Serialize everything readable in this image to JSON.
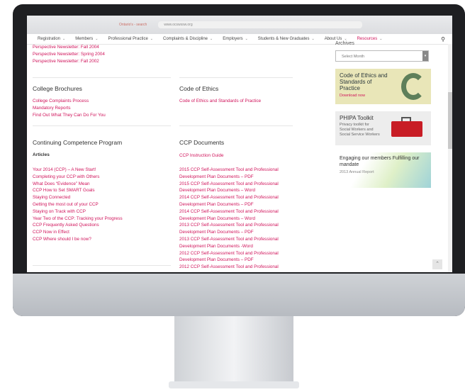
{
  "browser": {
    "tab1": "Ontario's - search",
    "address": "www.ocswssw.org"
  },
  "nav": {
    "items": [
      {
        "label": "Registration",
        "active": false
      },
      {
        "label": "Members",
        "active": false
      },
      {
        "label": "Professional Practice",
        "active": false
      },
      {
        "label": "Complaints & Discipline",
        "active": false
      },
      {
        "label": "Employers",
        "active": false
      },
      {
        "label": "Students & New Graduates",
        "active": false
      },
      {
        "label": "About Us",
        "active": false
      },
      {
        "label": "Resources",
        "active": true
      }
    ]
  },
  "newsletters": [
    "Perspective Newsletter: Fall 2004",
    "Perspective Newsletter: Spring 2004",
    "Perspective Newsletter: Fall 2002"
  ],
  "brochures": {
    "title": "College Brochures",
    "links": [
      "College Complaints Process",
      "Mandatory Reports",
      "Find Out What They Can Do For You"
    ]
  },
  "ethics": {
    "title": "Code of Ethics",
    "links": [
      "Code of Ethics and Standards of Practice"
    ]
  },
  "ccp": {
    "title": "Continuing Competence Program",
    "subhead": "Articles",
    "links": [
      "Your 2014 (CCP) – A New Start!",
      "Completing your CCP with Others",
      "What Does “Evidence” Mean",
      "CCP How to Set SMART Goals",
      "Staying Connected",
      "Getting the most out of your CCP",
      "Staying on Track with CCP",
      "Year Two of the CCP: Tracking your Progress",
      "CCP Frequently Asked Questions",
      "CCP Now in Effect",
      "CCP Where should I be now?"
    ]
  },
  "ccpdocs": {
    "title": "CCP Documents",
    "guide": "CCP Instruction Guide",
    "links": [
      "2015 CCP Self-Assessment Tool and Professional",
      "Development Plan Documents – PDF",
      "2015 CCP Self-Assessment Tool and Professional",
      "Development Plan Documents – Word",
      "2014 CCP Self-Assessment Tool and Professional",
      "Development Plan Documents – PDF",
      "2014 CCP Self-Assessment Tool and Professional",
      "Development Plan Documents – Word",
      "2013 CCP Self-Assessment Tool and Professional",
      "Development Plan Documents – PDF",
      "2013 CCP Self-Assessment Tool and Professional",
      "Development Plan Documents -Word",
      "2012 CCP Self-Assessment Tool and Professional",
      "Development Plan Documents – PDF",
      "2012 CCP Self-Assessment Tool and Professional"
    ]
  },
  "sidebar": {
    "archives_title": "Archives",
    "select_placeholder": "Select Month",
    "banner1_title": "Code of Ethics and Standards of Practice",
    "banner1_link": "Download now",
    "banner2_title": "PHIPA Toolkit",
    "banner2_text": "Privacy toolkit for Social Workers and Social Service Workers",
    "banner3_title": "Engaging our members Fulfilling our mandate",
    "banner3_text": "2013 Annual Report"
  },
  "colors": {
    "accent": "#d0145b"
  }
}
